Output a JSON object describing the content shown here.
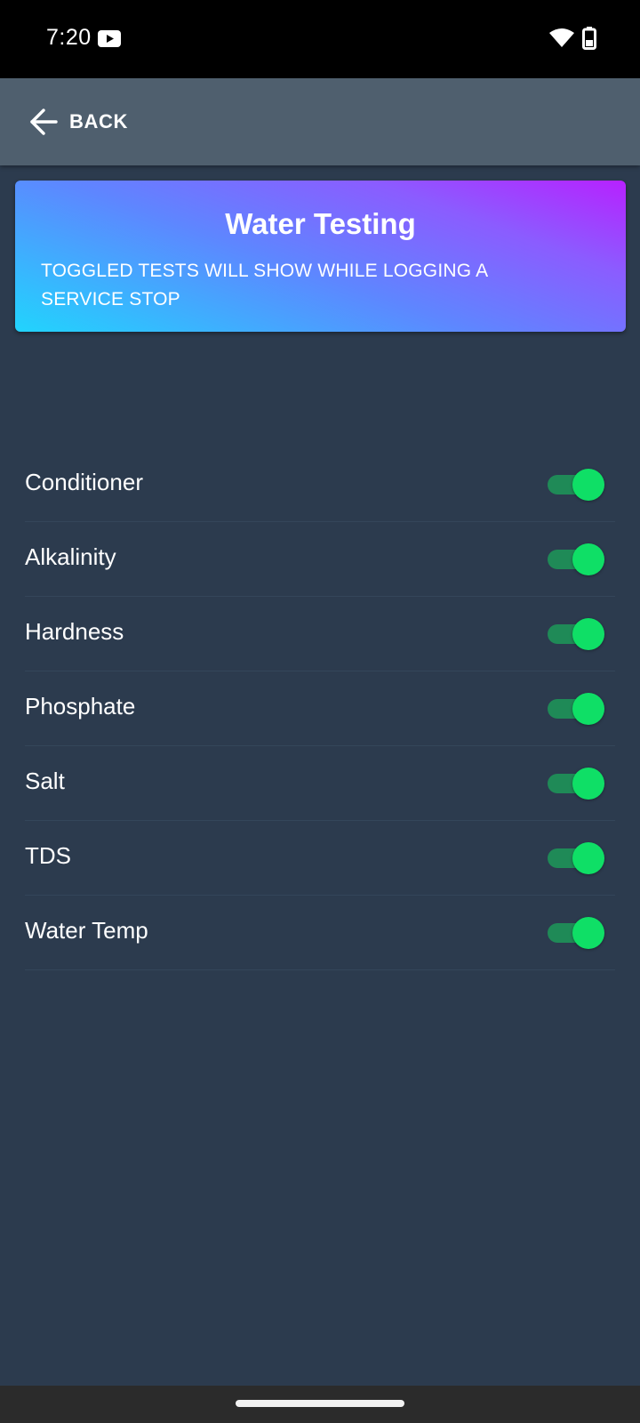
{
  "status_bar": {
    "time": "7:20",
    "icons": [
      "youtube-icon",
      "wifi-icon",
      "battery-icon"
    ]
  },
  "app_bar": {
    "back_label": "BACK"
  },
  "header": {
    "title": "Water Testing",
    "subtitle": "TOGGLED TESTS WILL SHOW WHILE LOGGING A SERVICE STOP"
  },
  "tests": [
    {
      "label": "Conditioner",
      "enabled": true
    },
    {
      "label": "Alkalinity",
      "enabled": true
    },
    {
      "label": "Hardness",
      "enabled": true
    },
    {
      "label": "Phosphate",
      "enabled": true
    },
    {
      "label": "Salt",
      "enabled": true
    },
    {
      "label": "TDS",
      "enabled": true
    },
    {
      "label": "Water Temp",
      "enabled": true
    }
  ],
  "colors": {
    "background": "#2c3b4e",
    "app_bar": "#4f5f6e",
    "toggle_track": "#1f8a57",
    "toggle_thumb": "#0fdf66",
    "gradient_start": "#21d4fd",
    "gradient_end": "#b721ff"
  }
}
